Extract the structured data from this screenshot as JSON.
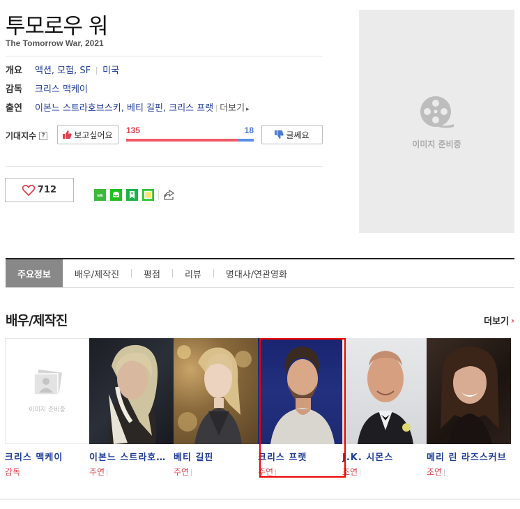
{
  "movie": {
    "title": "투모로우 워",
    "subtitle": "The Tomorrow War, 2021"
  },
  "info": {
    "overview_label": "개요",
    "genres": "액션, 모험, SF",
    "country": "미국",
    "director_label": "감독",
    "director": "크리스 맥케이",
    "cast_label": "출연",
    "cast_list": "이본느 스트라호브스키, 베티 길핀, 크리스 프랫",
    "more_label": "더보기"
  },
  "expectation": {
    "label": "기대지수",
    "help": "?",
    "want_label": "보고싶어요",
    "want_count": "135",
    "no_count": "18",
    "no_label": "글쎄요",
    "want_ratio": 0.88
  },
  "like": {
    "count": "712"
  },
  "poster": {
    "placeholder_text": "이미지 준비중"
  },
  "tabs": [
    {
      "label": "주요정보"
    },
    {
      "label": "배우/제작진"
    },
    {
      "label": "평점"
    },
    {
      "label": "리뷰"
    },
    {
      "label": "명대사/연관영화"
    }
  ],
  "section": {
    "title": "배우/제작진",
    "more_label": "더보기"
  },
  "cast_people": [
    {
      "name": "크리스 맥케이",
      "role": "감독",
      "placeholder": "이미지 준비중"
    },
    {
      "name": "이본느 스트라호브스키",
      "role": "주연"
    },
    {
      "name": "베티 길핀",
      "role": "주연"
    },
    {
      "name": "크리스 프랫",
      "role": "주연"
    },
    {
      "name": "J.K. 시몬스",
      "role": "조연"
    },
    {
      "name": "메리 린 라즈스커브",
      "role": "조연"
    }
  ],
  "colors": {
    "link": "#1f3d99",
    "accent_red": "#e3414d",
    "accent_blue": "#4a7ad8",
    "tab_active_bg": "#888888"
  }
}
